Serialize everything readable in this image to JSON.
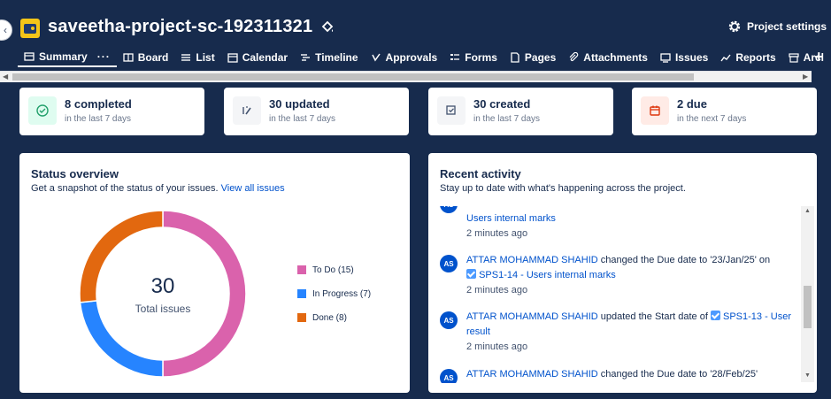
{
  "header": {
    "project_title": "saveetha-project-sc-192311321",
    "settings_label": "Project settings"
  },
  "tabs": [
    {
      "label": "Summary",
      "icon": "summary-icon"
    },
    {
      "label": "Board",
      "icon": "board-icon"
    },
    {
      "label": "List",
      "icon": "list-icon"
    },
    {
      "label": "Calendar",
      "icon": "calendar-icon"
    },
    {
      "label": "Timeline",
      "icon": "timeline-icon"
    },
    {
      "label": "Approvals",
      "icon": "approvals-icon"
    },
    {
      "label": "Forms",
      "icon": "forms-icon"
    },
    {
      "label": "Pages",
      "icon": "pages-icon"
    },
    {
      "label": "Attachments",
      "icon": "attachments-icon"
    },
    {
      "label": "Issues",
      "icon": "issues-icon"
    },
    {
      "label": "Reports",
      "icon": "reports-icon"
    },
    {
      "label": "Arcl",
      "icon": "archive-icon"
    }
  ],
  "tab_more": "···",
  "stats": [
    {
      "title": "8 completed",
      "sub": "in the last 7 days",
      "icon": "check-circle-icon",
      "icon_bg": "#dffcf0",
      "icon_color": "#22a06b"
    },
    {
      "title": "30 updated",
      "sub": "in the last 7 days",
      "icon": "edit-icon",
      "icon_bg": "#f4f5f7",
      "icon_color": "#42526e"
    },
    {
      "title": "30 created",
      "sub": "in the last 7 days",
      "icon": "created-icon",
      "icon_bg": "#f4f5f7",
      "icon_color": "#42526e"
    },
    {
      "title": "2 due",
      "sub": "in the next 7 days",
      "icon": "calendar-icon",
      "icon_bg": "#ffebe6",
      "icon_color": "#de350b"
    }
  ],
  "status": {
    "title": "Status overview",
    "subtitle": "Get a snapshot of the status of your issues.",
    "link": "View all issues",
    "total": "30",
    "total_label": "Total issues",
    "legend": [
      {
        "label": "To Do (15)",
        "value": 15,
        "color": "#da62ac"
      },
      {
        "label": "In Progress (7)",
        "value": 7,
        "color": "#2684ff"
      },
      {
        "label": "Done (8)",
        "value": 8,
        "color": "#e2680f"
      }
    ]
  },
  "activity": {
    "title": "Recent activity",
    "subtitle": "Stay up to date with what's happening across the project.",
    "item0_link": "Users internal marks",
    "item0_time": "2 minutes ago",
    "item1_user": "ATTAR MOHAMMAD SHAHID",
    "item1_action": "changed the Due date to '23/Jan/25' on",
    "item1_issue": "SPS1-14 - Users internal marks",
    "item1_time": "2 minutes ago",
    "item1_initials": "AS",
    "item2_user": "ATTAR MOHAMMAD SHAHID",
    "item2_action": "updated the Start date of",
    "item2_issue": "SPS1-13 - User result",
    "item2_time": "2 minutes ago",
    "item2_initials": "AS",
    "item3_user": "ATTAR MOHAMMAD SHAHID",
    "item3_action": "changed the Due date to '28/Feb/25'",
    "item3_initials": "AS"
  }
}
